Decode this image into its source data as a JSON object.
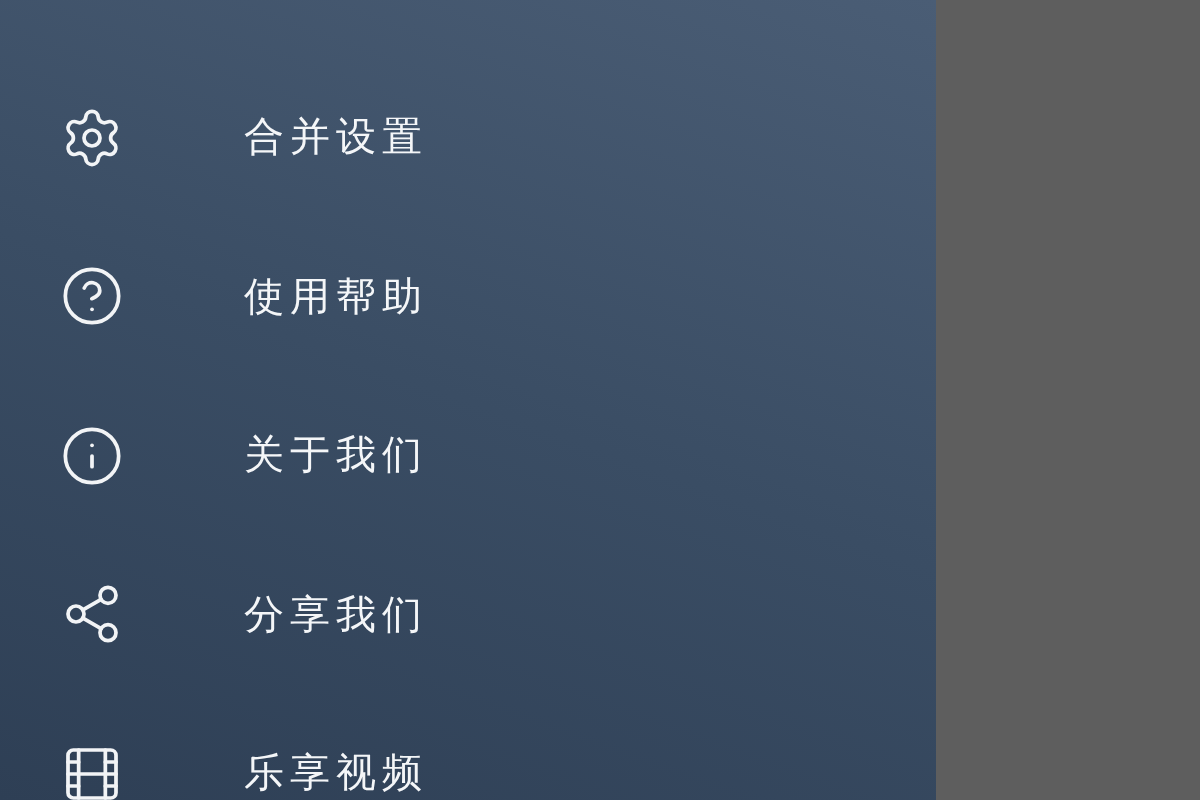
{
  "menu": {
    "items": [
      {
        "kind": "settings",
        "label": "合并设置"
      },
      {
        "kind": "help",
        "label": "使用帮助"
      },
      {
        "kind": "info",
        "label": "关于我们"
      },
      {
        "kind": "share",
        "label": "分享我们"
      },
      {
        "kind": "video",
        "label": "乐享视频"
      }
    ]
  }
}
